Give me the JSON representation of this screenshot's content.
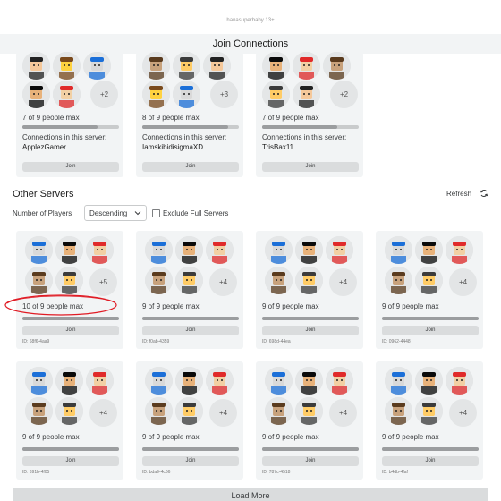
{
  "header": {
    "url_text": "hanasuperbaby 13+",
    "title": "Join Connections"
  },
  "connections": [
    {
      "count": "7 of 9 people max",
      "fill": 0.78,
      "label": "Connections in this server:",
      "name": "ApplezGamer",
      "join": "Join",
      "more": "+2"
    },
    {
      "count": "8 of 9 people max",
      "fill": 0.89,
      "label": "Connections in this server:",
      "name": "IamskibidisigmaXD",
      "join": "Join",
      "more": "+3"
    },
    {
      "count": "7 of 9 people max",
      "fill": 0.78,
      "label": "Connections in this server:",
      "name": "TrisBax11",
      "join": "Join",
      "more": "+2"
    }
  ],
  "other_servers": {
    "title": "Other Servers",
    "refresh_label": "Refresh",
    "num_players_label": "Number of Players",
    "sort_value": "Descending",
    "exclude_label": "Exclude Full Servers",
    "load_more": "Load More",
    "servers": [
      {
        "count": "10 of 9 people max",
        "fill": 1.0,
        "join": "Join",
        "id": "ID: 68f6-4aa9",
        "more": "+5"
      },
      {
        "count": "9 of 9 people max",
        "fill": 1.0,
        "join": "Join",
        "id": "ID: f0ab-4359",
        "more": "+4"
      },
      {
        "count": "9 of 9 people max",
        "fill": 1.0,
        "join": "Join",
        "id": "ID: 698d-44ea",
        "more": "+4"
      },
      {
        "count": "9 of 9 people max",
        "fill": 1.0,
        "join": "Join",
        "id": "ID: 0962-4448",
        "more": "+4"
      },
      {
        "count": "9 of 9 people max",
        "fill": 1.0,
        "join": "Join",
        "id": "ID: 691b-4f05",
        "more": "+4"
      },
      {
        "count": "9 of 9 people max",
        "fill": 1.0,
        "join": "Join",
        "id": "ID: bda9-4c66",
        "more": "+4"
      },
      {
        "count": "9 of 9 people max",
        "fill": 1.0,
        "join": "Join",
        "id": "ID: 787c-4518",
        "more": "+4"
      },
      {
        "count": "9 of 9 people max",
        "fill": 1.0,
        "join": "Join",
        "id": "ID: b4db-4faf",
        "more": "+4"
      }
    ]
  },
  "colors": {
    "card_bg": "#f2f4f5",
    "button_bg": "#dadcdd",
    "annotation_red": "#e01b24"
  }
}
